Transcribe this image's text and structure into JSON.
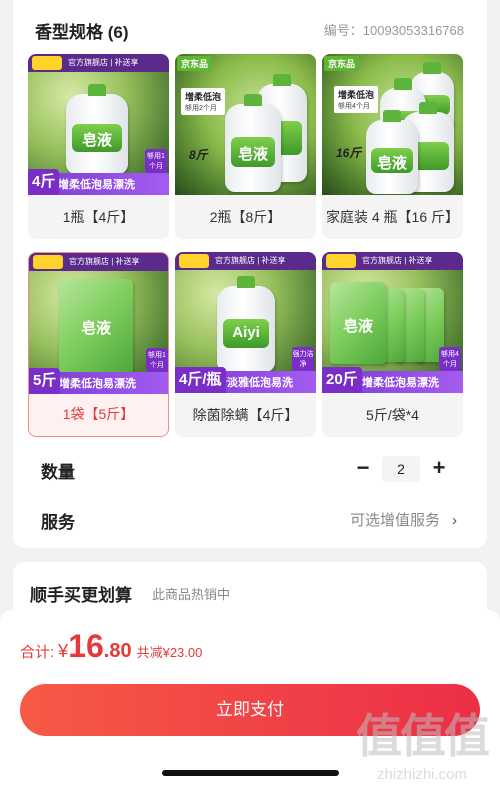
{
  "spec": {
    "title": "香型规格 (6)",
    "code": "编号：10093053316768"
  },
  "skus": [
    {
      "label": "1瓶【4斤】",
      "selected": false,
      "weight": "4斤",
      "promo": "增柔低泡易漂洗",
      "brand": "皂液",
      "top": "官方旗舰店 | 补送享",
      "side": "够用1个月"
    },
    {
      "label": "2瓶【8斤】",
      "selected": false,
      "weight": "8斤",
      "headline": "增柔低泡",
      "headline_sub": "够用2个月",
      "brand": "皂液",
      "badge": "京东品"
    },
    {
      "label": "家庭装 4 瓶【16 斤】",
      "selected": false,
      "weight": "16斤",
      "headline": "增柔低泡",
      "headline_sub": "够用4个月",
      "brand": "皂液",
      "badge": "京东品"
    },
    {
      "label": "1袋【5斤】",
      "selected": true,
      "weight": "5斤",
      "promo": "增柔低泡易漂洗",
      "brand": "皂液",
      "top": "官方旗舰店 | 补送享",
      "side": "够用1个月"
    },
    {
      "label": "除菌除螨【4斤】",
      "selected": false,
      "weight": "4斤/瓶",
      "promo": "清新淡雅低泡易洗",
      "brand": "Aiyi",
      "top": "官方旗舰店 | 补送享",
      "side": "强力洁净"
    },
    {
      "label": "5斤/袋*4",
      "selected": false,
      "weight": "20斤",
      "promo": "增柔低泡易漂洗",
      "brand": "皂液",
      "top": "官方旗舰店 | 补送享",
      "side": "够用4个月"
    }
  ],
  "quantity": {
    "label": "数量",
    "minus": "−",
    "value": "2",
    "plus": "+"
  },
  "service": {
    "label": "服务",
    "value": "可选增值服务",
    "chevron": "›"
  },
  "bundle": {
    "title": "顺手买更划算",
    "subtitle": "此商品热销中"
  },
  "footer": {
    "total_label": "合计:",
    "currency": "¥",
    "price_int": "16",
    "price_dec": ".80",
    "saving": "共减¥23.00",
    "pay_button": "立即支付"
  },
  "watermark": {
    "big": "值值值",
    "small": "zhizhizhi.com"
  },
  "colors": {
    "accent": "#e33a3a",
    "promo_purple": "#7a2ec8",
    "pay_gradient_start": "#f65a46",
    "pay_gradient_end": "#ec2e47"
  }
}
